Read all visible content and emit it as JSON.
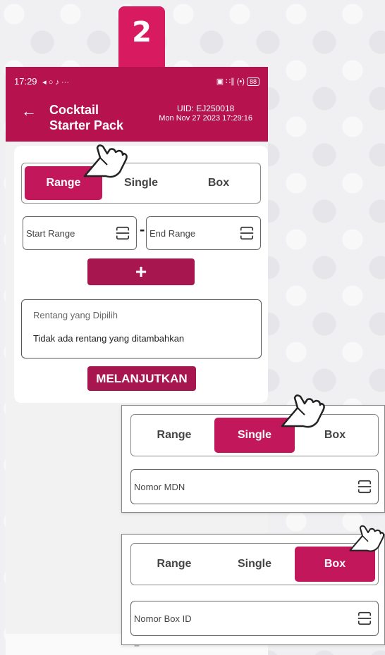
{
  "step_badge": "2",
  "status_bar": {
    "time": "17:29",
    "left_extra": "◂ ○ ♪ ···",
    "right_icons": "▣ ∷∥ (•) ",
    "battery": "88"
  },
  "app_bar": {
    "title_line1": "Cocktail",
    "title_line2": "Starter Pack",
    "uid": "UID: EJ250018",
    "datetime": "Mon Nov 27 2023 17:29:16"
  },
  "tabs": {
    "range": "Range",
    "single": "Single",
    "box": "Box"
  },
  "range_form": {
    "start_placeholder": "Start Range",
    "separator": "-",
    "end_placeholder": "End Range",
    "add_label": "+",
    "selected_label": "Rentang yang Dipilih",
    "selected_empty": "Tidak ada rentang yang ditambahkan",
    "continue_label": "MELANJUTKAN"
  },
  "nav_bar": {
    "menu": "≡"
  },
  "single_panel": {
    "active_tab": "single",
    "mdn_placeholder": "Nomor MDN"
  },
  "box_panel": {
    "active_tab": "box",
    "box_placeholder": "Nomor Box ID"
  },
  "icons": {
    "back": "arrow-left-icon",
    "scan": "scan-barcode-icon",
    "hand": "hand-pointer-icon"
  },
  "colors": {
    "primary": "#b5124e",
    "button": "#a8164f",
    "tab_active": "#c2185b",
    "badge": "#d81b60"
  }
}
